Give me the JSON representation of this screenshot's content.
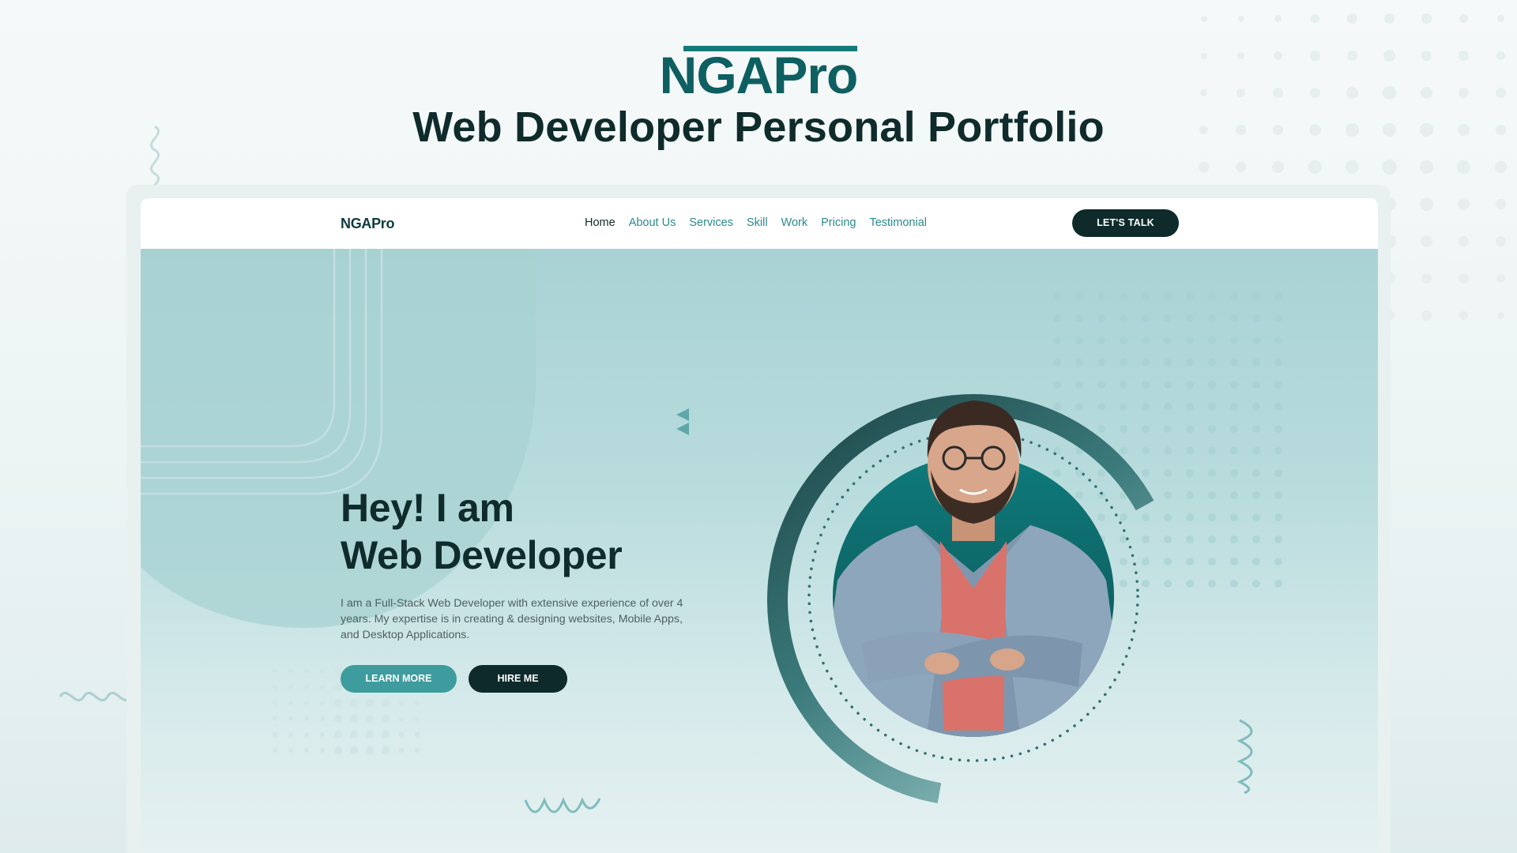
{
  "header": {
    "logo_text": "NGAPro",
    "title": "Web Developer Personal Portfolio"
  },
  "site": {
    "nav": {
      "logo_text": "NGAPro",
      "links": [
        "Home",
        "About Us",
        "Services",
        "Skill",
        "Work",
        "Pricing",
        "Testimonial"
      ],
      "active_link": "Home",
      "cta_label": "LET'S TALK"
    },
    "hero": {
      "title_line1": "Hey! I am",
      "title_line2": "Web Developer",
      "description": "I am a Full-Stack Web Developer with extensive experience of over 4 years. My expertise is in creating & designing websites, Mobile Apps, and Desktop Applications.",
      "learn_more_label": "LEARN MORE",
      "hire_me_label": "HIRE ME",
      "portrait_icon": "developer-portrait-image"
    }
  },
  "colors": {
    "brand_teal": "#137a7c",
    "dark": "#0e2a2b",
    "link": "#2a8a8c",
    "hero_bg": "#b3d8d9"
  }
}
